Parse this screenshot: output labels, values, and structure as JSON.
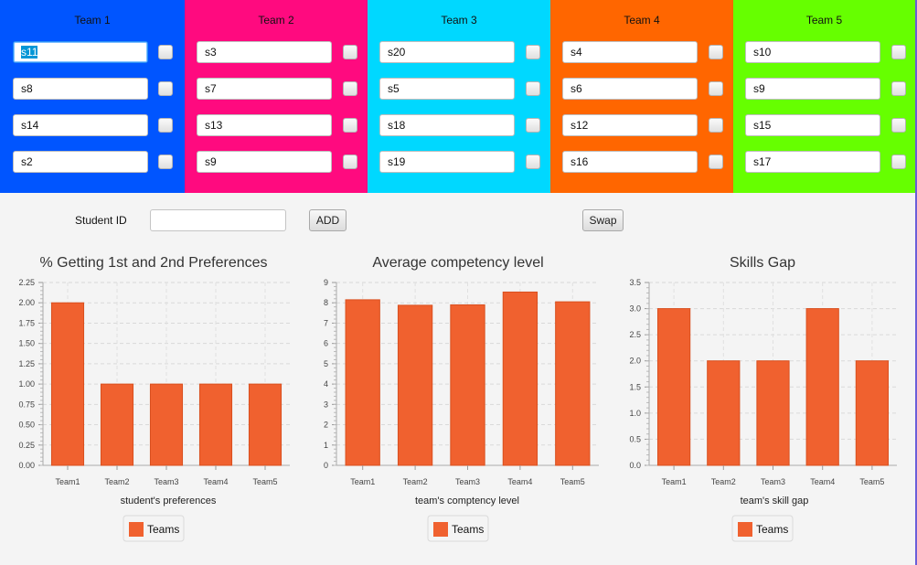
{
  "teams": [
    {
      "title": "Team 1",
      "color": "#0055ff",
      "members": [
        "s11",
        "s8",
        "s14",
        "s2"
      ]
    },
    {
      "title": "Team 2",
      "color": "#ff0a7f",
      "members": [
        "s3",
        "s7",
        "s13",
        "s9"
      ]
    },
    {
      "title": "Team 3",
      "color": "#00d8ff",
      "members": [
        "s20",
        "s5",
        "s18",
        "s19"
      ]
    },
    {
      "title": "Team 4",
      "color": "#ff6600",
      "members": [
        "s4",
        "s6",
        "s12",
        "s16"
      ]
    },
    {
      "title": "Team 5",
      "color": "#66ff00",
      "members": [
        "s10",
        "s9",
        "s15",
        "s17"
      ]
    }
  ],
  "controls": {
    "student_id_label": "Student ID",
    "student_id_value": "",
    "add_label": "ADD",
    "swap_label": "Swap"
  },
  "bar_color": "#f0612f",
  "chart_data": [
    {
      "type": "bar",
      "title": "% Getting 1st and 2nd Preferences",
      "categories": [
        "Team1",
        "Team2",
        "Team3",
        "Team4",
        "Team5"
      ],
      "series": [
        {
          "name": "Teams",
          "values": [
            2.0,
            1.0,
            1.0,
            1.0,
            1.0
          ]
        }
      ],
      "xlabel": "student's preferences",
      "ylabel": "",
      "ylim": [
        0,
        2.25
      ],
      "yticks": [
        "0.00",
        "0.25",
        "0.50",
        "0.75",
        "1.00",
        "1.25",
        "1.50",
        "1.75",
        "2.00",
        "2.25"
      ],
      "grid": true,
      "legend": "bottom"
    },
    {
      "type": "bar",
      "title": "Average competency level",
      "categories": [
        "Team1",
        "Team2",
        "Team3",
        "Team4",
        "Team5"
      ],
      "series": [
        {
          "name": "Teams",
          "values": [
            8.15,
            7.88,
            7.9,
            8.53,
            8.05
          ]
        }
      ],
      "xlabel": "team's comptency level",
      "ylabel": "",
      "ylim": [
        0,
        9
      ],
      "yticks": [
        "0",
        "1",
        "2",
        "3",
        "4",
        "5",
        "6",
        "7",
        "8",
        "9"
      ],
      "grid": true,
      "legend": "bottom"
    },
    {
      "type": "bar",
      "title": "Skills Gap",
      "categories": [
        "Team1",
        "Team2",
        "Team3",
        "Team4",
        "Team5"
      ],
      "series": [
        {
          "name": "Teams",
          "values": [
            3.0,
            2.0,
            2.0,
            3.0,
            2.0
          ]
        }
      ],
      "xlabel": "team's skill gap",
      "ylabel": "",
      "ylim": [
        0,
        3.5
      ],
      "yticks": [
        "0.0",
        "0.5",
        "1.0",
        "1.5",
        "2.0",
        "2.5",
        "3.0",
        "3.5"
      ],
      "grid": true,
      "legend": "bottom"
    }
  ]
}
